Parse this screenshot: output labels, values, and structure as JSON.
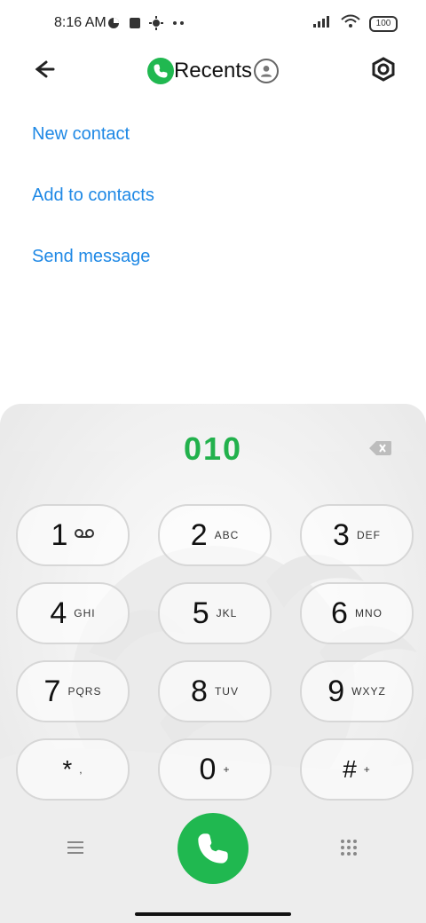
{
  "status": {
    "time": "8:16 AM",
    "battery": "100"
  },
  "header": {
    "title": "Recents"
  },
  "actions": [
    {
      "label": "New contact"
    },
    {
      "label": "Add to contacts"
    },
    {
      "label": "Send message"
    }
  ],
  "dialer": {
    "number": "010",
    "keys": [
      {
        "main": "1",
        "sub": ""
      },
      {
        "main": "2",
        "sub": "ABC"
      },
      {
        "main": "3",
        "sub": "DEF"
      },
      {
        "main": "4",
        "sub": "GHI"
      },
      {
        "main": "5",
        "sub": "JKL"
      },
      {
        "main": "6",
        "sub": "MNO"
      },
      {
        "main": "7",
        "sub": "PQRS"
      },
      {
        "main": "8",
        "sub": "TUV"
      },
      {
        "main": "9",
        "sub": "WXYZ"
      },
      {
        "main": "*",
        "sub": ","
      },
      {
        "main": "0",
        "sub": "+"
      },
      {
        "main": "#",
        "sub": "+"
      }
    ]
  },
  "colors": {
    "accent_link": "#1e88e5",
    "accent_green": "#20b850"
  },
  "icons": {
    "back": "back-arrow-icon",
    "settings": "settings-icon",
    "phone": "phone-icon",
    "person": "person-icon",
    "voicemail": "voicemail-icon",
    "backspace": "backspace-icon",
    "menu": "menu-icon",
    "dialpad": "dialpad-icon"
  }
}
